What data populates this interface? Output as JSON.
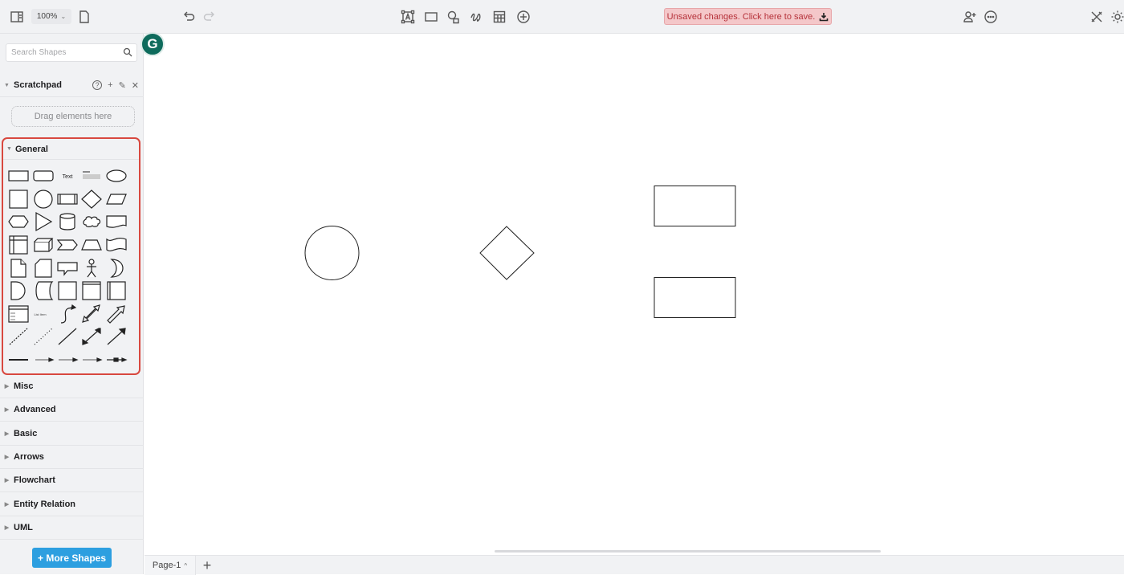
{
  "toolbar": {
    "zoom_level": "100%",
    "unsaved_notice": "Unsaved changes. Click here to save.",
    "icons_left": [
      "sidebar-toggle-icon",
      "page-icon",
      "undo-icon",
      "redo-icon"
    ],
    "icons_center": [
      "text-icon",
      "rectangle-icon",
      "shapes-icon",
      "freehand-icon",
      "table-icon",
      "insert-icon"
    ],
    "icons_right": [
      "share-icon",
      "more-icon",
      "tools-icon",
      "theme-icon"
    ]
  },
  "sidebar": {
    "search_placeholder": "Search Shapes",
    "scratchpad": {
      "title": "Scratchpad",
      "actions": [
        "?",
        "+",
        "✎",
        "✕"
      ],
      "dropzone_text": "Drag elements here"
    },
    "general": {
      "title": "General",
      "shapes": [
        "rectangle",
        "rounded-rectangle",
        "text",
        "textbox",
        "ellipse",
        "square",
        "circle",
        "process",
        "diamond",
        "parallelogram",
        "hexagon",
        "triangle",
        "cylinder",
        "cloud",
        "document",
        "internal-storage",
        "cube",
        "step",
        "trapezoid",
        "tape",
        "note",
        "card",
        "callout",
        "actor",
        "or",
        "delay",
        "data-storage",
        "rect-square",
        "container-header",
        "container-side",
        "list",
        "list-item",
        "curved-arrow",
        "bidirectional-arrow",
        "arrow",
        "dashed-line",
        "dotted-line",
        "line",
        "bidirectional-connector",
        "directional-connector",
        "thick-line",
        "connector-label",
        "connector-2-labels",
        "connector-3-labels",
        "connector-symbol"
      ],
      "text_shape_label": "Text",
      "list_item_label": "List Item"
    },
    "sections": [
      "Misc",
      "Advanced",
      "Basic",
      "Arrows",
      "Flowchart",
      "Entity Relation",
      "UML"
    ],
    "more_shapes_label": "+ More Shapes"
  },
  "canvas": {
    "shapes": [
      {
        "type": "ellipse",
        "label": ""
      },
      {
        "type": "diamond",
        "label": ""
      },
      {
        "type": "rectangle",
        "label": ""
      },
      {
        "type": "rectangle",
        "label": ""
      }
    ]
  },
  "pages": {
    "tabs": [
      "Page-1"
    ],
    "add_label": "+"
  },
  "colors": {
    "accent": "#2d9fe0",
    "unsaved_bg": "#f4c7c9",
    "unsaved_text": "#b5323a",
    "highlight_border": "#d8483f",
    "grammarly": "#0e6b5c"
  }
}
